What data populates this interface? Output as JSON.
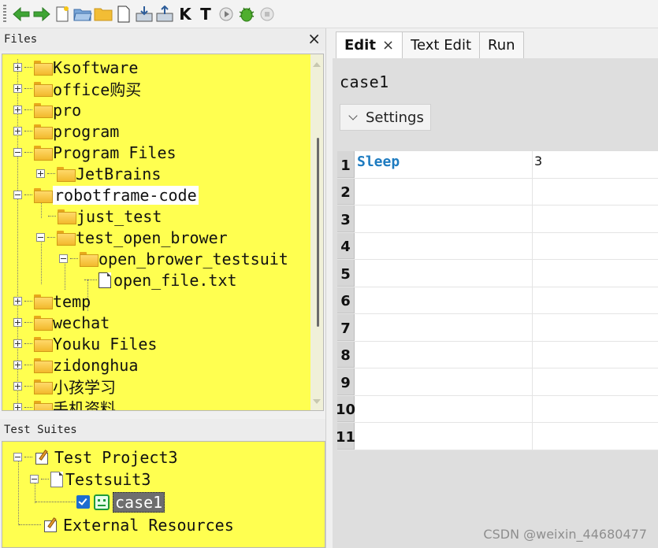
{
  "files": {
    "header": "Files",
    "close": "×",
    "items": [
      "Ksoftware",
      "office购买",
      "pro",
      "program",
      "Program Files",
      "JetBrains",
      "robotframe-code",
      "just_test",
      "test_open_brower",
      "open_brower_testsuit",
      "open_file.txt",
      "temp",
      "wechat",
      "Youku Files",
      "zidonghua",
      "小孩学习",
      "手机资料"
    ]
  },
  "suites": {
    "header": "Test Suites",
    "project": "Test Project3",
    "suite": "Testsuit3",
    "case": "case1",
    "external": "External Resources"
  },
  "tabs": {
    "edit": "Edit",
    "edit_close": "×",
    "text_edit": "Text Edit",
    "run": "Run"
  },
  "editor": {
    "title": "case1",
    "settings": "Settings",
    "rows": [
      {
        "num": "1",
        "keyword": "Sleep",
        "arg": "3"
      },
      {
        "num": "2",
        "keyword": "",
        "arg": ""
      },
      {
        "num": "3",
        "keyword": "",
        "arg": ""
      },
      {
        "num": "4",
        "keyword": "",
        "arg": ""
      },
      {
        "num": "5",
        "keyword": "",
        "arg": ""
      },
      {
        "num": "6",
        "keyword": "",
        "arg": ""
      },
      {
        "num": "7",
        "keyword": "",
        "arg": ""
      },
      {
        "num": "8",
        "keyword": "",
        "arg": ""
      },
      {
        "num": "9",
        "keyword": "",
        "arg": ""
      },
      {
        "num": "10",
        "keyword": "",
        "arg": ""
      },
      {
        "num": "11",
        "keyword": "",
        "arg": ""
      }
    ]
  },
  "toolbar": {
    "k_label": "K",
    "t_label": "T",
    "icons": [
      "back-arrow-icon",
      "forward-arrow-icon",
      "new-file-icon",
      "open-folder-icon",
      "folder-icon",
      "blank-page-icon",
      "import-icon",
      "export-icon",
      "keyword-search-icon",
      "test-search-icon",
      "run-icon",
      "bug-icon",
      "stop-icon"
    ]
  },
  "watermark": "CSDN @weixin_44680477"
}
